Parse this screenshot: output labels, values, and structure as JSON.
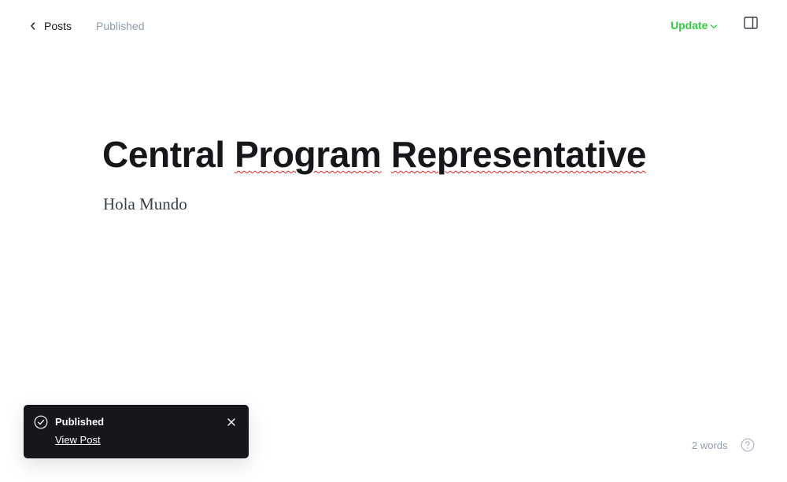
{
  "header": {
    "back_label": "Posts",
    "status": "Published",
    "update_label": "Update"
  },
  "post": {
    "title_words": [
      "Central",
      "Program",
      "Representative"
    ],
    "body": "Hola Mundo"
  },
  "footer": {
    "word_count": "2 words"
  },
  "toast": {
    "title": "Published",
    "link_label": "View Post"
  },
  "colors": {
    "accent_green": "#30cf43",
    "muted_text": "#8e9cac",
    "toast_bg": "#15171a",
    "spellcheck_underline": "#e02424"
  },
  "icons": {
    "back": "chevron-left-icon",
    "update": "chevron-down-icon",
    "sidebar": "sidebar-toggle-icon",
    "help": "help-circle-icon",
    "toast_status": "check-circle-icon",
    "toast_close": "close-icon"
  }
}
